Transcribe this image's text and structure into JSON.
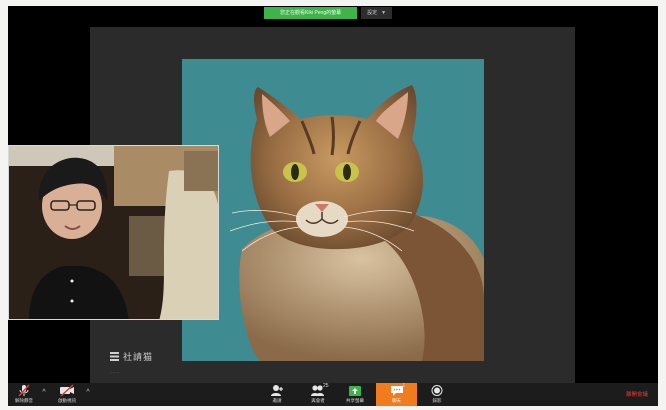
{
  "share_banner": {
    "status": "您正在觀看Kiki Peng的螢幕",
    "settings_label": "設定",
    "settings_icon": "chevron-down-icon"
  },
  "slide": {
    "logo_text": "社請猫",
    "footnote": "·······"
  },
  "toolbar": {
    "unmute_label": "解除靜音",
    "start_video_label": "啟動視訊",
    "invite_label": "邀請",
    "participants_label": "與會者",
    "participants_count": "25",
    "share_label": "共享螢幕",
    "chat_label": "聊天",
    "chat_badge": "1",
    "record_label": "錄影",
    "end_label": "離開會議"
  },
  "colors": {
    "share_green": "#3eb34a",
    "chat_orange": "#f07c1b",
    "end_red": "#e53a32",
    "photo_teal": "#3f8b92"
  }
}
